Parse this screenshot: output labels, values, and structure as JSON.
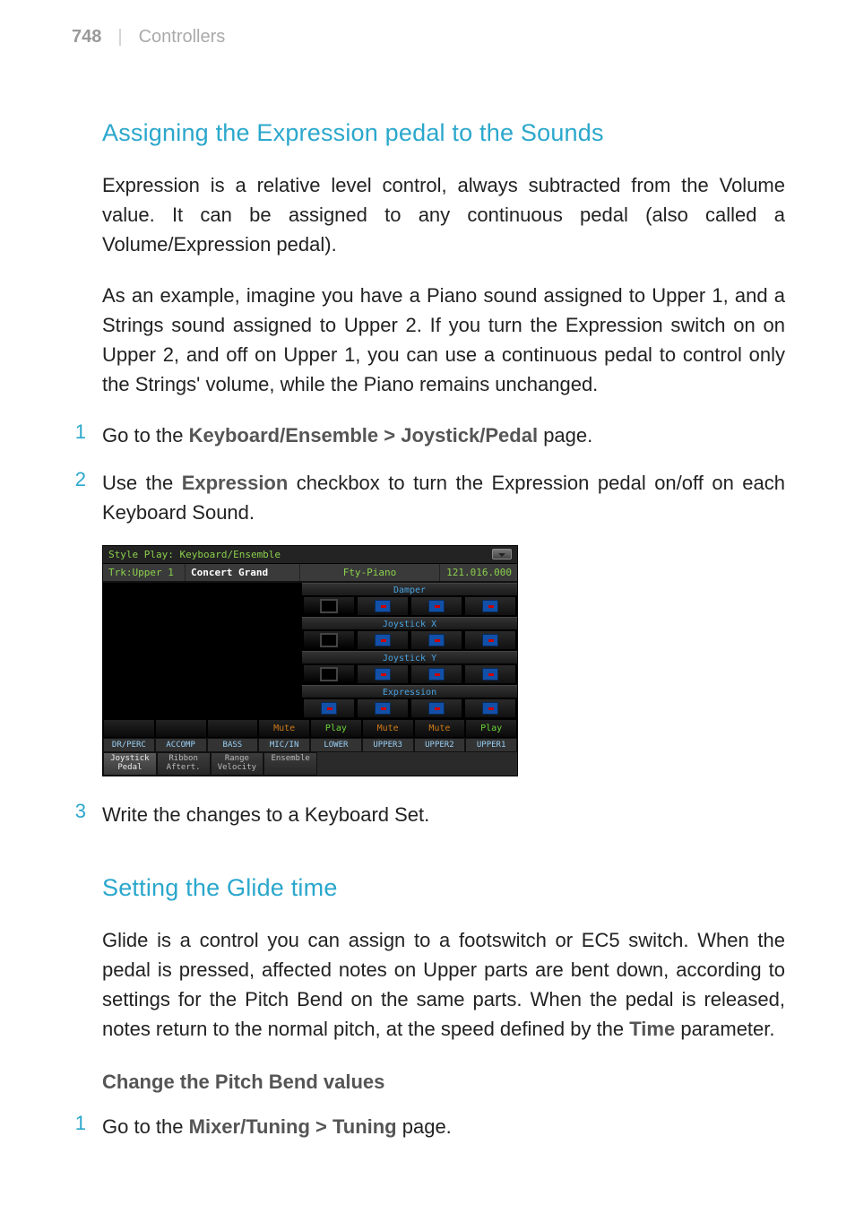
{
  "header": {
    "page_number": "748",
    "divider": "|",
    "section": "Controllers"
  },
  "section1": {
    "heading": "Assigning the Expression pedal to the Sounds",
    "p1": "Expression is a relative level control, always subtracted from the Volume value. It can be assigned to any continuous pedal (also called a Volume/Expression pedal).",
    "p2": "As an example, imagine you have a Piano sound assigned to Upper 1, and a Strings sound assigned to Upper 2. If you turn the Expression switch on on Upper 2, and off on Upper 1, you can use a continuous pedal to control only the Strings' volume, while the Piano remains unchanged.",
    "step1_num": "1",
    "step1_pre": "Go to the ",
    "step1_strong": "Keyboard/Ensemble > Joystick/Pedal",
    "step1_post": " page.",
    "step2_num": "2",
    "step2_pre": "Use the ",
    "step2_strong": "Expression",
    "step2_post": " checkbox to turn the Expression pedal on/off on each Keyboard Sound.",
    "step3_num": "3",
    "step3_text": "Write the changes to a Keyboard Set."
  },
  "ui": {
    "title": "Style Play: Keyboard/Ensemble",
    "trk": "Trk:Upper 1",
    "sound_name": "Concert Grand",
    "family": "Fty-Piano",
    "prog_num": "121.016.000",
    "params": [
      "Damper",
      "Joystick X",
      "Joystick Y",
      "Expression"
    ],
    "pm": [
      "",
      "",
      "",
      "Mute",
      "Play",
      "Mute",
      "Mute",
      "Play"
    ],
    "tracks": [
      "DR/PERC",
      "ACCOMP",
      "BASS",
      "MIC/IN",
      "LOWER",
      "UPPER3",
      "UPPER2",
      "UPPER1"
    ],
    "tabs": [
      "Joystick\nPedal",
      "Ribbon\nAftert.",
      "Range\nVelocity",
      "Ensemble"
    ]
  },
  "section2": {
    "heading": "Setting the Glide time",
    "p1_pre": "Glide is a control you can assign to a footswitch or EC5 switch. When the pedal is pressed, affected notes on Upper parts are bent down, according to settings for the Pitch Bend on the same parts. When the pedal is released, notes return to the normal pitch, at the speed defined by the ",
    "p1_strong": "Time",
    "p1_post": " parameter.",
    "sub": "Change the Pitch Bend values",
    "step1_num": "1",
    "step1_pre": "Go to the ",
    "step1_strong": "Mixer/Tuning > Tuning",
    "step1_post": " page."
  }
}
